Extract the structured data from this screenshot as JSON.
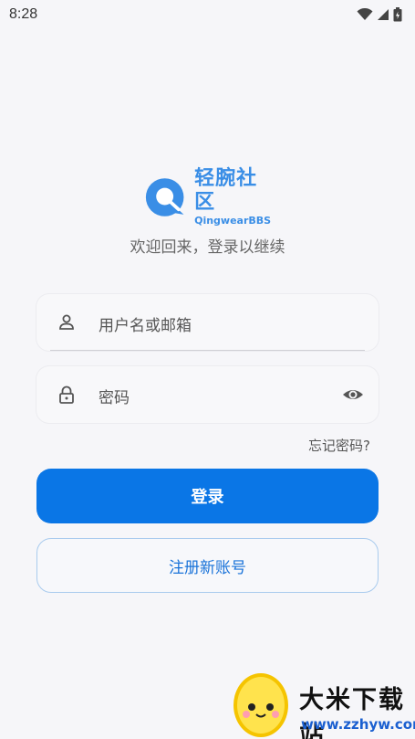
{
  "status_bar": {
    "time": "8:28",
    "icons": [
      "wifi-icon",
      "signal-icon",
      "battery-icon"
    ]
  },
  "brand": {
    "name_cn": "轻腕社区",
    "name_en": "QingwearBBS",
    "color": "#3a8ee6"
  },
  "welcome_text": "欢迎回来，登录以继续",
  "form": {
    "username_placeholder": "用户名或邮箱",
    "password_placeholder": "密码",
    "forgot_password": "忘记密码?"
  },
  "buttons": {
    "login": "登录",
    "register": "注册新账号"
  },
  "colors": {
    "primary": "#0a76e6",
    "background": "#f6f6f9"
  },
  "watermark": {
    "title": "大米下载站",
    "url": "www.zzhyw.com"
  }
}
